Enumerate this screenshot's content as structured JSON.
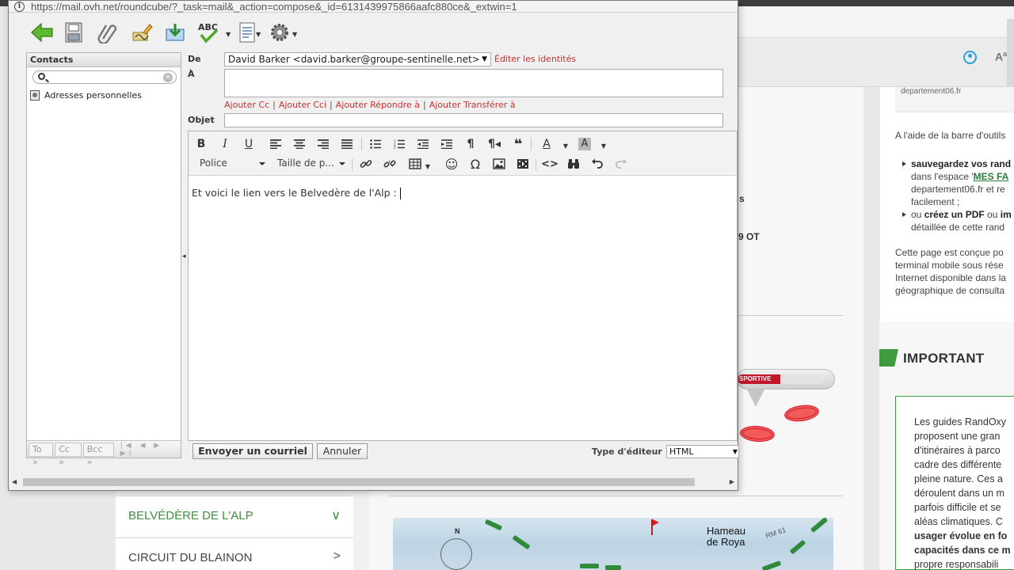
{
  "background_page": {
    "right_col": {
      "logo_text": "departement06.fr",
      "intro": "A l'aide de la barre d'outils",
      "bullets": [
        {
          "bold": "sauvegardez vos rand",
          "line2_prefix": "dans l'espace '",
          "line2_link": "MES FA",
          "line3": "departement06.fr et re",
          "line4": "facilement ;"
        },
        {
          "prefix": "ou ",
          "bold1": "créez un PDF",
          "mid": " ou ",
          "bold2": "im",
          "line2": "détaillée de cette rand"
        }
      ],
      "paragraph": [
        "Cette page est conçue po",
        "terminal mobile sous rése",
        "Internet disponible dans la",
        "géographique de consulta"
      ]
    },
    "important": {
      "title": "IMPORTANT",
      "lines": [
        "Les guides RandOxy",
        "proposent une gran",
        "d'itinéraires à parco",
        "cadre des différente",
        "pleine nature. Ces a",
        "déroulent dans un m",
        "parfois difficile et se",
        "aléas climatiques. C",
        "usager évolue en fo",
        "capacités dans ce m",
        "propre responsabili"
      ]
    },
    "fragments": {
      "a": "s",
      "b": "9 OT"
    },
    "gauge_label": "SPORTIVE",
    "menu": [
      {
        "label": "BELVÉDÈRE DE L'ALP",
        "chevron": "∨"
      },
      {
        "label": "CIRCUIT DU BLAINON",
        "chevron": ">"
      }
    ],
    "map": {
      "place": "Hameau\nde Roya",
      "road": "RM 61",
      "north": "N"
    }
  },
  "popup": {
    "url": "https://mail.ovh.net/roundcube/?_task=mail&_action=compose&_id=6131439975866aafc880ce&_extwin=1",
    "toolbar": {
      "back": "back-arrow-icon",
      "spell_label": "ABC"
    },
    "contacts": {
      "header": "Contacts",
      "search_placeholder": "",
      "addressbook": "Adresses personnelles",
      "footer": {
        "to": "To »",
        "cc": "Cc »",
        "bcc": "Bcc »",
        "nav": "|◀ ◀ ▶ ▶|"
      }
    },
    "compose": {
      "from_label": "De",
      "from_value": "David Barker <david.barker@groupe-sentinelle.net>",
      "edit_identities": "Éditer les identités",
      "to_label": "À",
      "to_value": "",
      "add_links": [
        "Ajouter Cc",
        "Ajouter Cci",
        "Ajouter Répondre à",
        "Ajouter Transférer à"
      ],
      "link_sep": "|",
      "subject_label": "Objet",
      "subject_value": ""
    },
    "editor": {
      "font_label": "Police",
      "size_label": "Taille de p...",
      "body": "Et voici le lien vers le Belvedère de l'Alp :"
    },
    "actions": {
      "send": "Envoyer un courriel",
      "cancel": "Annuler",
      "editor_type_label": "Type d'éditeur",
      "editor_type_value": "HTML"
    }
  },
  "colors": {
    "accent_red": "#c43232",
    "accent_green": "#3f8e3f"
  }
}
